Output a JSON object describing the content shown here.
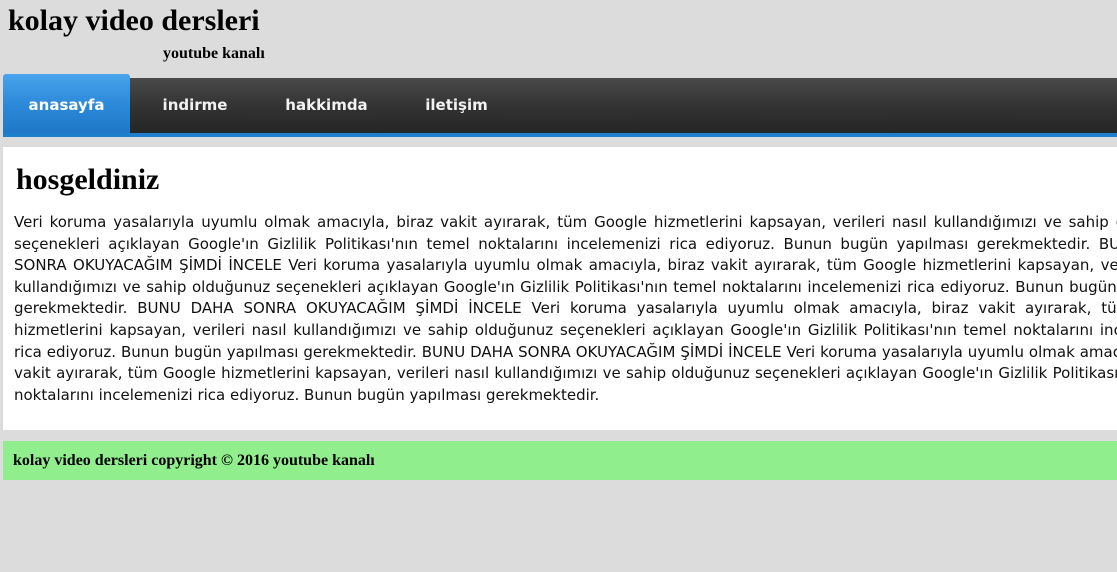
{
  "header": {
    "title": "kolay video dersleri",
    "subtitle": "youtube kanalı"
  },
  "nav": {
    "items": [
      {
        "label": "anasayfa",
        "active": true
      },
      {
        "label": "indirme",
        "active": false
      },
      {
        "label": "hakkimda",
        "active": false
      },
      {
        "label": "iletişim",
        "active": false
      }
    ]
  },
  "main": {
    "heading": "hosgeldiniz",
    "body": "Veri koruma yasalarıyla uyumlu olmak amacıyla, biraz vakit ayırarak, tüm Google hizmetlerini kapsayan, verileri nasıl kullandığımızı ve sahip olduğunuz seçenekleri açıklayan Google'ın Gizlilik Politikası'nın temel noktalarını incelemenizi rica ediyoruz. Bunun bugün yapılması gerekmektedir. BUNU DAHA SONRA OKUYACAĞIM ŞİMDİ İNCELE Veri koruma yasalarıyla uyumlu olmak amacıyla, biraz vakit ayırarak, tüm Google hizmetlerini kapsayan, verileri nasıl kullandığımızı ve sahip olduğunuz seçenekleri açıklayan Google'ın Gizlilik Politikası'nın temel noktalarını incelemenizi rica ediyoruz. Bunun bugün yapılması gerekmektedir. BUNU DAHA SONRA OKUYACAĞIM ŞİMDİ İNCELE Veri koruma yasalarıyla uyumlu olmak amacıyla, biraz vakit ayırarak, tüm Google hizmetlerini kapsayan, verileri nasıl kullandığımızı ve sahip olduğunuz seçenekleri açıklayan Google'ın Gizlilik Politikası'nın temel noktalarını incelemenizi rica ediyoruz. Bunun bugün yapılması gerekmektedir. BUNU DAHA SONRA OKUYACAĞIM ŞİMDİ İNCELE Veri koruma yasalarıyla uyumlu olmak amacıyla, biraz vakit ayırarak, tüm Google hizmetlerini kapsayan, verileri nasıl kullandığımızı ve sahip olduğunuz seçenekleri açıklayan Google'ın Gizlilik Politikası'nın temel noktalarını incelemenizi rica ediyoruz. Bunun bugün yapılması gerekmektedir."
  },
  "footer": {
    "text": "kolay video dersleri copyright © 2016 youtube kanalı"
  },
  "colors": {
    "page_background": "#dcdcdc",
    "nav_background": "#333333",
    "nav_active": "#2b88d8",
    "content_background": "#ffffff",
    "footer_background": "#90ee8c"
  }
}
